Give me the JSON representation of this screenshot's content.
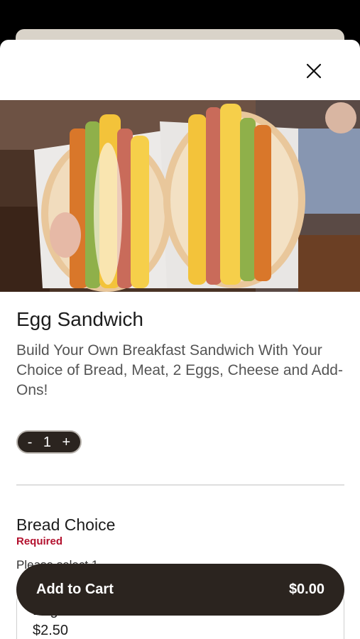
{
  "item": {
    "title": "Egg Sandwich",
    "description": "Build Your Own Breakfast Sandwich With Your Choice of Bread, Meat, 2 Eggs, Cheese and Add-Ons!",
    "image_icon": "sandwich-photo"
  },
  "quantity": {
    "minus": "-",
    "value": "1",
    "plus": "+"
  },
  "bread_section": {
    "title": "Bread Choice",
    "required_label": "Required",
    "helper": "Please select 1",
    "options": [
      {
        "name": "Bagel",
        "price": "$2.50"
      }
    ]
  },
  "cart": {
    "label": "Add to Cart",
    "total": "$0.00"
  },
  "colors": {
    "dark": "#2b241f",
    "required": "#b3112e"
  },
  "icons": {
    "close": "close-icon"
  }
}
